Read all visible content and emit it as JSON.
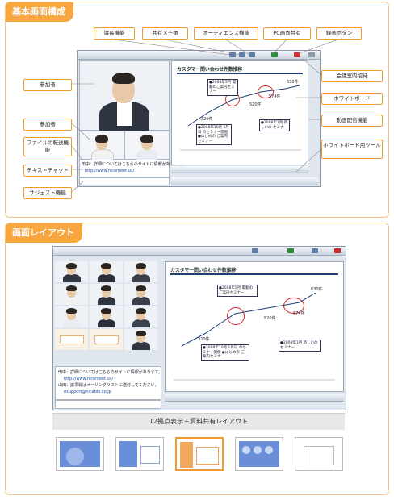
{
  "sections": {
    "basic": {
      "title": "基本画面構成"
    },
    "layout": {
      "title": "画面レイアウト"
    }
  },
  "callouts": {
    "chair": "議長機能",
    "memo": "共有メモ張",
    "audience": "オーディエンス機能",
    "pc_share": "PC画面共有",
    "record": "録画ボタン",
    "invite": "会議室内招待",
    "whiteboard": "ホワイトボード",
    "video": "動画配信機能",
    "wb_tools": "ホワイトボード用ツール",
    "participant1": "参加者",
    "participant2": "参加者",
    "file_transfer": "ファイルの転送機能",
    "text_chat": "テキストチャット",
    "suggest": "サジェスト機能"
  },
  "whiteboard": {
    "title": "カスタマー問い合わせ件数推移",
    "values": [
      "320件",
      "520件",
      "574件",
      "630件"
    ],
    "note1": "●2008年5月 電動のご案内セミナー",
    "note2": "●2008年10月 1月日 のセミナー開催 ●はじめの ご案内セミナー",
    "note3": "●2008年1月 新しいの セミナー"
  },
  "chat": {
    "line1": "田中：詳細についてはこちらのサイトに情報があります。",
    "line2": "http://www.nicemeet.us/",
    "line3": "山田：議事録はメーリングリストに送付してください。",
    "line4": "nsupport@nicable.co.jp"
  },
  "layout_caption": "12拠点表示＋資料共有レイアウト",
  "colors": {
    "accent": "#f8a740",
    "callout_border": "#f39a2c",
    "circle": "#d4262a"
  }
}
